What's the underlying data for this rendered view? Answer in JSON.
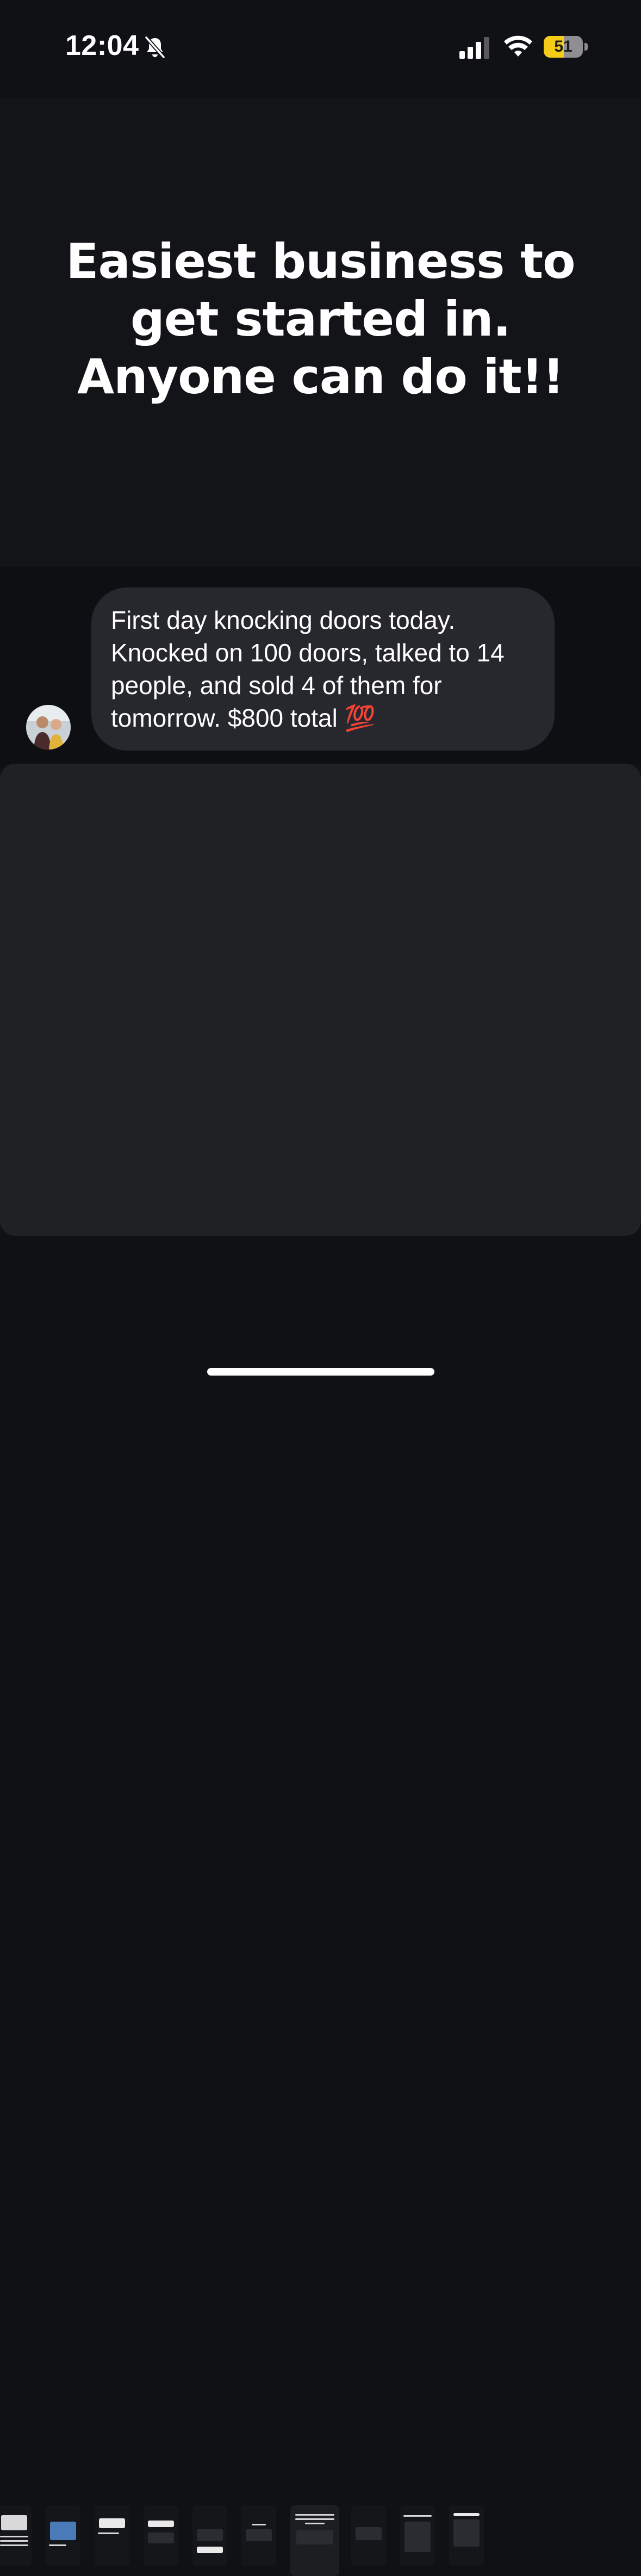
{
  "status_bar": {
    "time": "12:04",
    "battery_level": "51",
    "battery_fraction": 0.51,
    "battery_color": "#f5cc17",
    "icons": [
      "bell-slash-icon",
      "cellular-signal-icon",
      "wifi-icon",
      "battery-icon"
    ]
  },
  "post": {
    "headline": "Easiest business to get started in. Anyone can do it!!"
  },
  "message": {
    "text": "First day knocking doors today. Knocked on 100 doors, talked to 14 people, and sold 4 of them for tomorrow. $800 total 💯",
    "bubble_color": "#26282d"
  },
  "thumbnails": {
    "count": 10,
    "current_index": 6
  },
  "colors": {
    "background": "#0f1114",
    "title_area": "#121418",
    "panel": "#1f2125",
    "text": "#ffffff"
  }
}
